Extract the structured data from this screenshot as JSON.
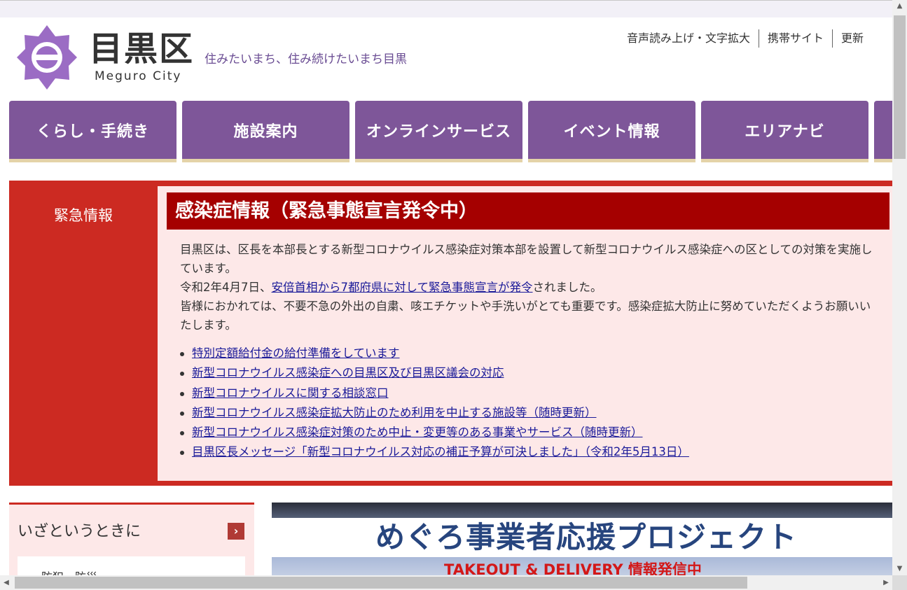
{
  "header": {
    "brand_ja": "目黒区",
    "brand_en": "Meguro City",
    "tagline": "住みたいまち、住み続けたいまち目黒",
    "utility_links": [
      "音声読み上げ・文字拡大",
      "携帯サイト",
      "更新"
    ]
  },
  "nav": {
    "items": [
      "くらし・手続き",
      "施設案内",
      "オンラインサービス",
      "イベント情報",
      "エリアナビ"
    ]
  },
  "emergency": {
    "label": "緊急情報",
    "title": "感染症情報（緊急事態宣言発令中）",
    "para1": "目黒区は、区長を本部長とする新型コロナウイルス感染症対策本部を設置して新型コロナウイルス感染症への区としての対策を実施しています。",
    "para2_prefix": "令和2年4月7日、",
    "para2_link": "安倍首相から7都府県に対して緊急事態宣言が発令",
    "para2_suffix": "されました。",
    "para3": "皆様におかれては、不要不急の外出の自粛、咳エチケットや手洗いがとても重要です。感染症拡大防止に努めていただくようお願いいたします。",
    "links": [
      "特別定額給付金の給付準備をしています",
      "新型コロナウイルス感染症への目黒区及び目黒区議会の対応",
      "新型コロナウイルスに関する相談窓口",
      "新型コロナウイルス感染症拡大防止のため利用を中止する施設等（随時更新）",
      "新型コロナウイルス感染症対策のため中止・変更等のある事業やサービス（随時更新）",
      "目黒区長メッセージ「新型コロナウイルス対応の補正予算が可決しました」（令和2年5月13日）"
    ]
  },
  "sidebar": {
    "title": "いざというときに",
    "first_item": "防犯・防災"
  },
  "banner": {
    "title": "めぐろ事業者応援プロジェクト",
    "subtitle": "TAKEOUT & DELIVERY 情報発信中"
  },
  "colors": {
    "nav_purple": "#7e5699",
    "emergency_red": "#cc2a22",
    "title_red": "#a50000",
    "tagline_purple": "#6a4c93",
    "link_blue": "#1a1a99"
  },
  "icons": [
    "meguro-emblem-icon",
    "chevron-right-icon",
    "scroll-up-icon",
    "scroll-down-icon",
    "scroll-left-icon",
    "scroll-right-icon"
  ]
}
